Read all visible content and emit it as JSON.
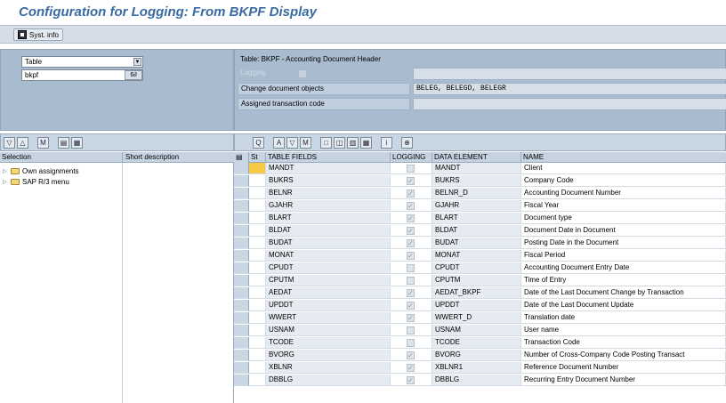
{
  "title": "Configuration for Logging: From BKPF Display",
  "toolbar": {
    "syst_info_label": "Syst. info"
  },
  "selection": {
    "object_type": "Table",
    "object_name": "bkpf",
    "display_button": "6∂"
  },
  "left_toolbar": {
    "icons": [
      "filter-icon",
      "sort-icon",
      "find-icon",
      "print-icon",
      "layout-icon"
    ],
    "glyphs": [
      "▽",
      "△",
      "M",
      "▤",
      "▦"
    ]
  },
  "left_tree": {
    "headers": [
      "Selection",
      "Short description"
    ],
    "nodes": [
      {
        "label": "Own assignments",
        "icon": "folder-icon"
      },
      {
        "label": "SAP R/3 menu",
        "icon": "folder-icon"
      }
    ]
  },
  "detail": {
    "table_caption": "Table: BKPF - Accounting Document Header",
    "logging_label": "Logging",
    "change_doc_label": "Change document objects",
    "change_doc_value": "BELEG, BELEGD, BELEGR",
    "assigned_tcode_label": "Assigned transaction code",
    "assigned_tcode_value": ""
  },
  "right_toolbar": {
    "icons": [
      "details-icon",
      "print-icon",
      "filter-icon",
      "find-icon",
      "export-icon",
      "layout-icon",
      "grid-icon",
      "graphic-icon",
      "info-icon",
      "expand-icon"
    ],
    "glyphs": [
      "Q",
      "A",
      "▽",
      "M",
      "□",
      "◫",
      "▥",
      "▦",
      "i",
      "⊕"
    ]
  },
  "grid": {
    "headers": [
      "St",
      "TABLE FIELDS",
      "LOGGING",
      "DATA ELEMENT",
      "NAME"
    ],
    "rows": [
      {
        "field": "MANDT",
        "logging": false,
        "element": "MANDT",
        "name": "Client",
        "status_color": "#f7c845"
      },
      {
        "field": "BUKRS",
        "logging": true,
        "element": "BUKRS",
        "name": "Company Code"
      },
      {
        "field": "BELNR",
        "logging": true,
        "element": "BELNR_D",
        "name": "Accounting Document Number"
      },
      {
        "field": "GJAHR",
        "logging": true,
        "element": "GJAHR",
        "name": "Fiscal Year"
      },
      {
        "field": "BLART",
        "logging": true,
        "element": "BLART",
        "name": "Document type"
      },
      {
        "field": "BLDAT",
        "logging": true,
        "element": "BLDAT",
        "name": "Document Date in Document"
      },
      {
        "field": "BUDAT",
        "logging": true,
        "element": "BUDAT",
        "name": "Posting Date in the Document"
      },
      {
        "field": "MONAT",
        "logging": true,
        "element": "MONAT",
        "name": "Fiscal Period"
      },
      {
        "field": "CPUDT",
        "logging": false,
        "element": "CPUDT",
        "name": "Accounting Document Entry Date"
      },
      {
        "field": "CPUTM",
        "logging": false,
        "element": "CPUTM",
        "name": "Time of Entry"
      },
      {
        "field": "AEDAT",
        "logging": true,
        "element": "AEDAT_BKPF",
        "name": "Date of the Last Document Change by Transaction"
      },
      {
        "field": "UPDDT",
        "logging": true,
        "element": "UPDDT",
        "name": "Date of the Last Document Update"
      },
      {
        "field": "WWERT",
        "logging": true,
        "element": "WWERT_D",
        "name": "Translation date"
      },
      {
        "field": "USNAM",
        "logging": false,
        "element": "USNAM",
        "name": "User name"
      },
      {
        "field": "TCODE",
        "logging": false,
        "element": "TCODE",
        "name": "Transaction Code"
      },
      {
        "field": "BVORG",
        "logging": true,
        "element": "BVORG",
        "name": "Number of Cross-Company Code Posting Transact"
      },
      {
        "field": "XBLNR",
        "logging": true,
        "element": "XBLNR1",
        "name": "Reference Document Number"
      },
      {
        "field": "DBBLG",
        "logging": true,
        "element": "DBBLG",
        "name": "Recurring Entry Document Number"
      }
    ]
  }
}
